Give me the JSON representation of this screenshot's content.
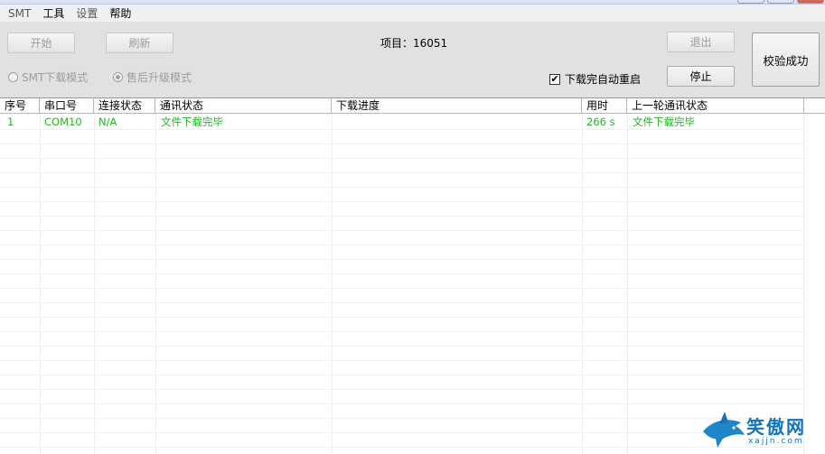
{
  "menubar": {
    "items": [
      "SMT",
      "工具",
      "设置",
      "帮助"
    ]
  },
  "toolbar": {
    "start_label": "开始",
    "refresh_label": "刷新",
    "project_label": "项目：16051",
    "exit_label": "退出",
    "stop_label": "停止",
    "verify_label": "校验成功",
    "radio_smt": "SMT下载模式",
    "radio_aftersale": "售后升级模式",
    "auto_restart_label": "下载完自动重启",
    "auto_restart_checked": true,
    "check_mark": "✔"
  },
  "table": {
    "columns": [
      "序号",
      "串口号",
      "连接状态",
      "通讯状态",
      "下载进度",
      "用时",
      "上一轮通讯状态"
    ],
    "rows": [
      {
        "index": "1",
        "port": "COM10",
        "connection": "N/A",
        "comm_status": "文件下载完毕",
        "progress": "",
        "time": "266 s",
        "last_status": "文件下载完毕"
      }
    ],
    "row_text_color": "#22b722"
  },
  "watermark": {
    "text": "笑傲网",
    "sub": "xajjn.com"
  }
}
